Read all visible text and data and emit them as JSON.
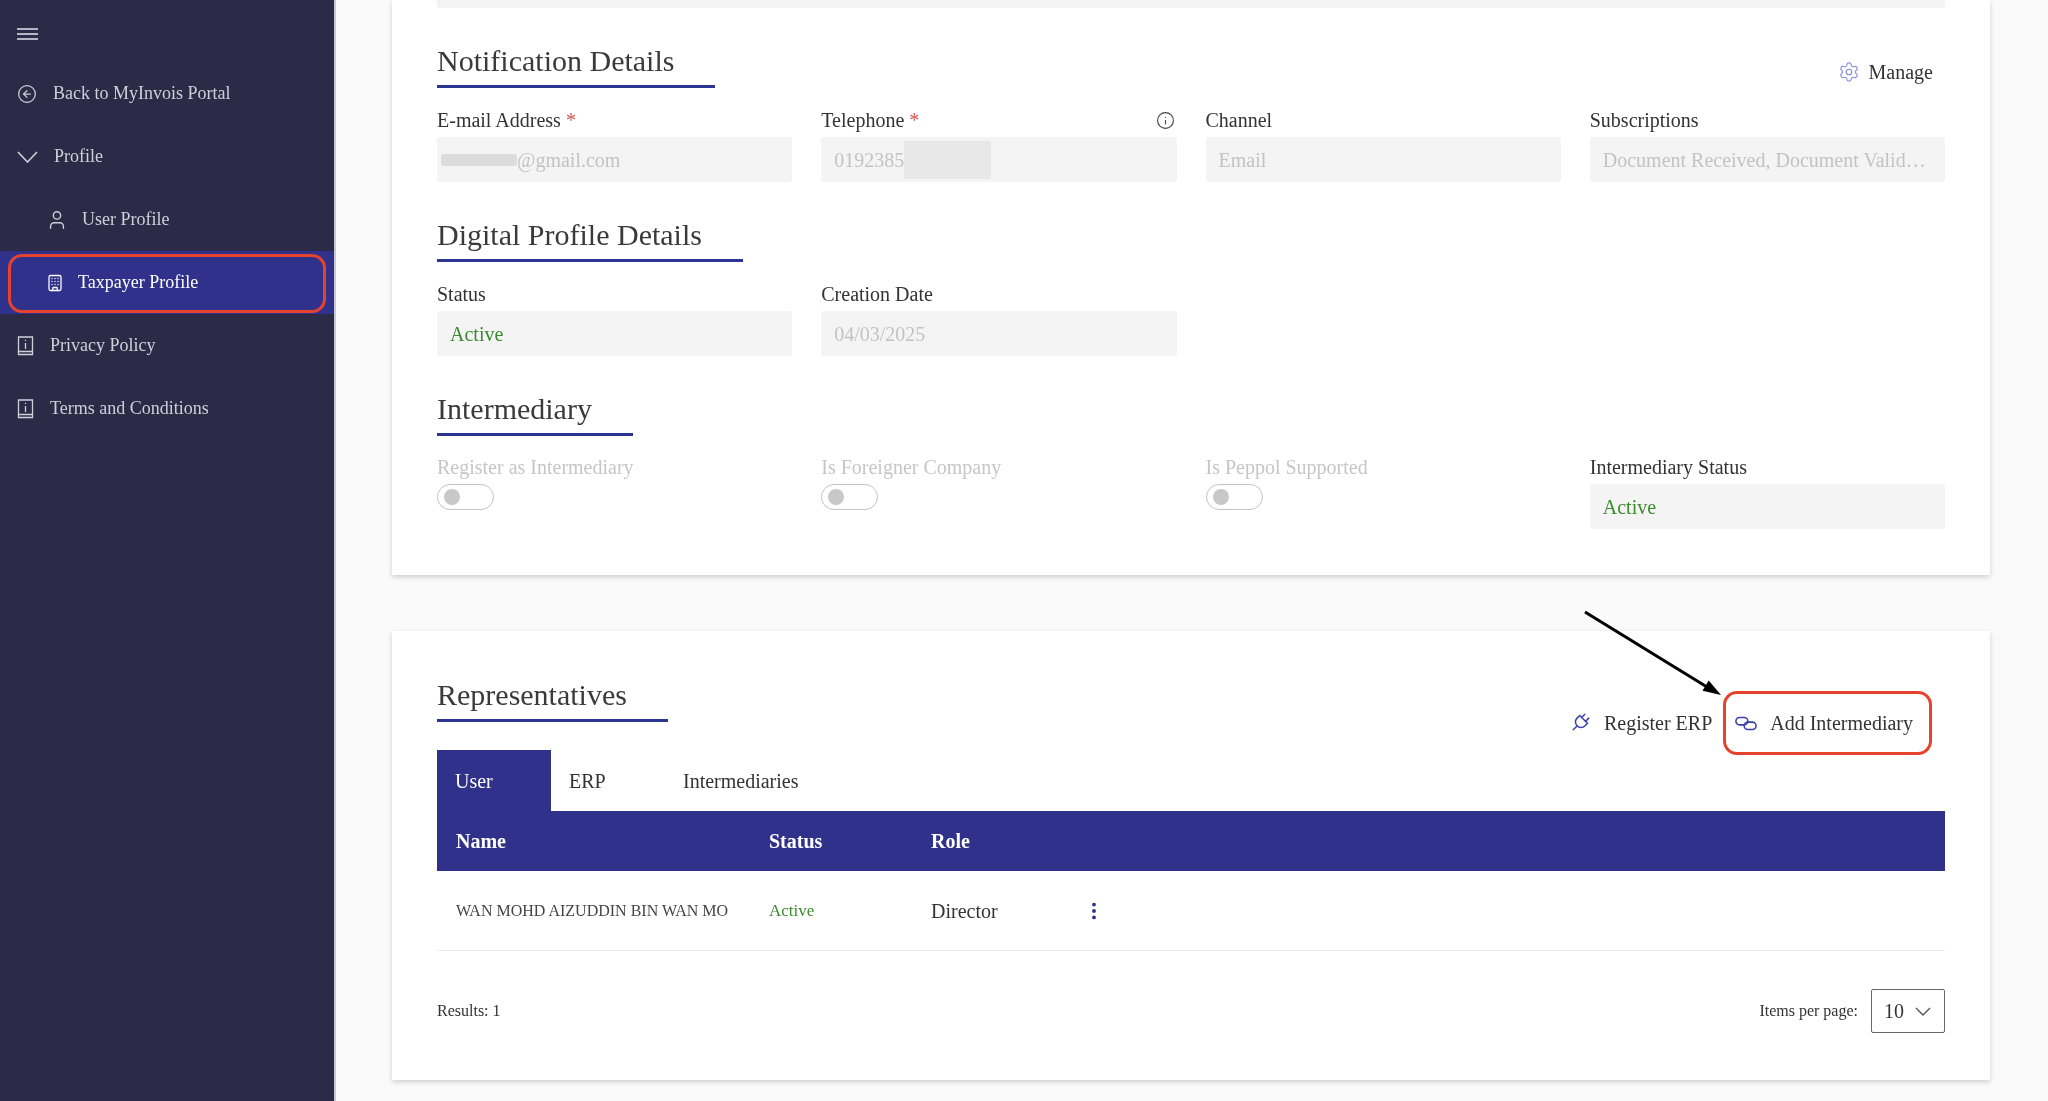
{
  "sidebar": {
    "items": [
      {
        "kind": "back",
        "label": "Back to MyInvois Portal",
        "selected": false,
        "highlighted": false
      },
      {
        "kind": "group",
        "label": "Profile",
        "selected": false,
        "highlighted": false,
        "expanded": true,
        "children": [
          {
            "label": "User Profile",
            "selected": false,
            "highlighted": false
          },
          {
            "label": "Taxpayer Profile",
            "selected": true,
            "highlighted": true
          }
        ]
      },
      {
        "kind": "document",
        "label": "Privacy Policy",
        "selected": false,
        "highlighted": false
      },
      {
        "kind": "document",
        "label": "Terms and Conditions",
        "selected": false,
        "highlighted": false
      }
    ]
  },
  "notification_details": {
    "title": "Notification Details",
    "manage_button": "Manage",
    "fields": [
      {
        "label": "E-mail Address",
        "required_mark": "*",
        "info": false,
        "kind": "muted",
        "value_parts": [
          {
            "kind": "mask"
          },
          {
            "kind": "text",
            "text": "@gmail.com"
          }
        ]
      },
      {
        "label": "Telephone",
        "required_mark": "*",
        "info": true,
        "kind": "muted",
        "value_parts": [
          {
            "kind": "text",
            "text": "0192385"
          },
          {
            "kind": "mask"
          }
        ]
      },
      {
        "label": "Channel",
        "info": false,
        "kind": "muted",
        "value": "Email"
      },
      {
        "label": "Subscriptions",
        "info": false,
        "kind": "muted",
        "value": "Document Received, Document Valid…"
      }
    ]
  },
  "digital_profile_details": {
    "title": "Digital Profile Details",
    "fields": [
      {
        "label": "Status",
        "kind": "status",
        "value": "Active"
      },
      {
        "label": "Creation Date",
        "kind": "muted",
        "value": "04/03/2025"
      }
    ]
  },
  "intermediary": {
    "title": "Intermediary",
    "items": [
      {
        "kind": "toggle",
        "label": "Register as Intermediary",
        "on": false,
        "disabled": true
      },
      {
        "kind": "toggle",
        "label": "Is Foreigner Company",
        "on": false,
        "disabled": true
      },
      {
        "kind": "toggle",
        "label": "Is Peppol Supported",
        "on": false,
        "disabled": true
      },
      {
        "kind": "status",
        "label": "Intermediary Status",
        "value": "Active"
      }
    ]
  },
  "representatives": {
    "title": "Representatives",
    "actions": [
      {
        "label": "Register ERP",
        "highlighted": false
      },
      {
        "label": "Add Intermediary",
        "highlighted": true
      }
    ],
    "tabs": [
      {
        "label": "User",
        "selected": true
      },
      {
        "label": "ERP",
        "selected": false
      },
      {
        "label": "Intermediaries",
        "selected": false
      }
    ],
    "table": {
      "columns": [
        "Name",
        "Status",
        "Role"
      ],
      "rows": [
        {
          "name": "WAN MOHD AIZUDDIN BIN WAN MO",
          "status": "Active",
          "role": "Director"
        }
      ]
    },
    "results": "Results: 1",
    "page_size": {
      "label": "Items per page:",
      "value": "10"
    }
  }
}
